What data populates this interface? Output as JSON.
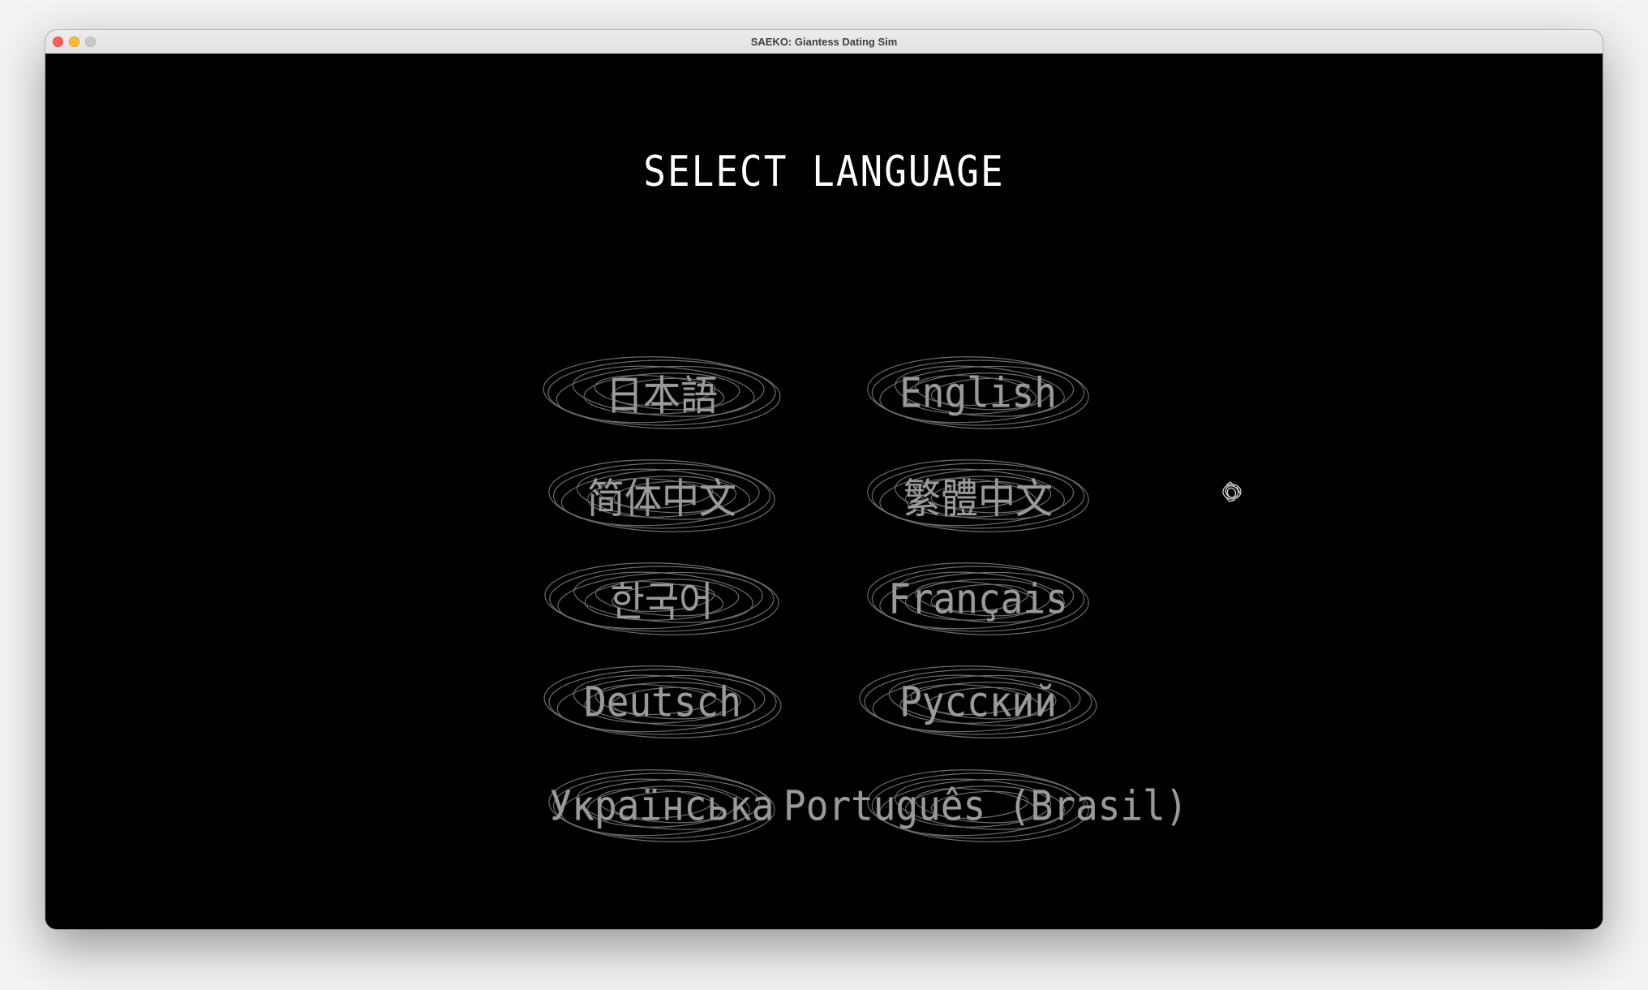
{
  "window": {
    "title": "SAEKO: Giantess Dating Sim"
  },
  "screen": {
    "heading": "SELECT LANGUAGE"
  },
  "languages": [
    {
      "label": "日本語"
    },
    {
      "label": "English"
    },
    {
      "label": "简体中文"
    },
    {
      "label": "繁體中文"
    },
    {
      "label": "한국어"
    },
    {
      "label": "Français"
    },
    {
      "label": "Deutsch"
    },
    {
      "label": "Русский"
    },
    {
      "label": "Українська"
    },
    {
      "label": "Português (Brasil)"
    }
  ],
  "colors": {
    "background": "#000000",
    "heading": "#ffffff",
    "option_text": "#9a9a9a",
    "scribble": "#6d6d6d"
  }
}
